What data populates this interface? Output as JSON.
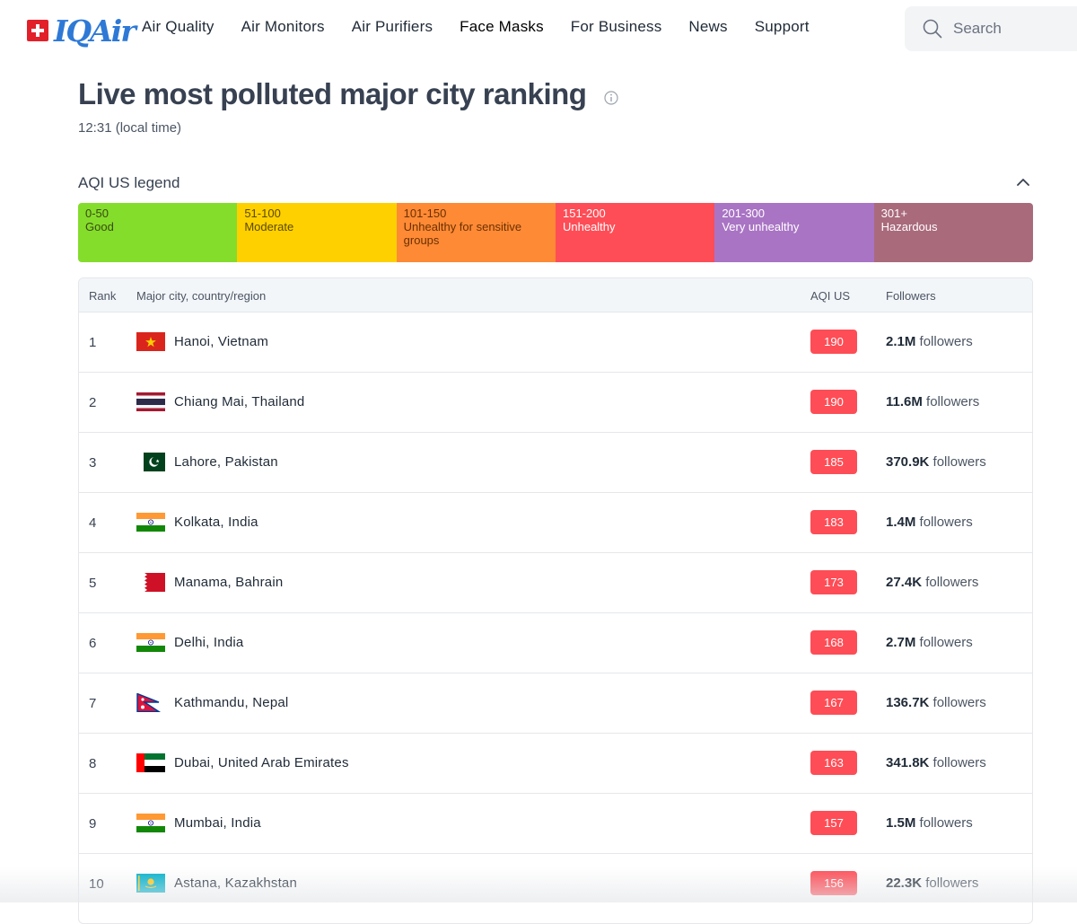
{
  "header": {
    "logo_text": "IQAir",
    "nav": [
      {
        "label": "Air Quality"
      },
      {
        "label": "Air Monitors"
      },
      {
        "label": "Air Purifiers"
      },
      {
        "label": "Face Masks"
      },
      {
        "label": "For Business"
      },
      {
        "label": "News"
      },
      {
        "label": "Support"
      }
    ],
    "search_placeholder": "Search"
  },
  "page": {
    "title": "Live most polluted major city ranking",
    "local_time": "12:31 (local time)"
  },
  "legend": {
    "title": "AQI US legend",
    "segments": [
      {
        "range": "0-50",
        "label": "Good",
        "color": "#84dd2b",
        "text_color": "#3a4a12"
      },
      {
        "range": "51-100",
        "label": "Moderate",
        "color": "#ffd000",
        "text_color": "#5a4a00"
      },
      {
        "range": "101-150",
        "label": "Unhealthy for sensitive groups",
        "color": "#fe8a36",
        "text_color": "#6b3000"
      },
      {
        "range": "151-200",
        "label": "Unhealthy",
        "color": "#fe4d56",
        "text_color": "#ffffff"
      },
      {
        "range": "201-300",
        "label": "Very unhealthy",
        "color": "#a974c4",
        "text_color": "#ffffff"
      },
      {
        "range": "301+",
        "label": "Hazardous",
        "color": "#a96a7c",
        "text_color": "#ffffff"
      }
    ]
  },
  "table": {
    "headers": {
      "rank": "Rank",
      "city": "Major city, country/region",
      "aqi": "AQI US",
      "followers": "Followers"
    },
    "followers_suffix": "followers",
    "rows": [
      {
        "rank": "1",
        "city": "Hanoi, Vietnam",
        "flag": "vietnam",
        "aqi": "190",
        "followers": "2.1M"
      },
      {
        "rank": "2",
        "city": "Chiang Mai, Thailand",
        "flag": "thailand",
        "aqi": "190",
        "followers": "11.6M"
      },
      {
        "rank": "3",
        "city": "Lahore, Pakistan",
        "flag": "pakistan",
        "aqi": "185",
        "followers": "370.9K"
      },
      {
        "rank": "4",
        "city": "Kolkata, India",
        "flag": "india",
        "aqi": "183",
        "followers": "1.4M"
      },
      {
        "rank": "5",
        "city": "Manama, Bahrain",
        "flag": "bahrain",
        "aqi": "173",
        "followers": "27.4K"
      },
      {
        "rank": "6",
        "city": "Delhi, India",
        "flag": "india",
        "aqi": "168",
        "followers": "2.7M"
      },
      {
        "rank": "7",
        "city": "Kathmandu, Nepal",
        "flag": "nepal",
        "aqi": "167",
        "followers": "136.7K"
      },
      {
        "rank": "8",
        "city": "Dubai, United Arab Emirates",
        "flag": "uae",
        "aqi": "163",
        "followers": "341.8K"
      },
      {
        "rank": "9",
        "city": "Mumbai, India",
        "flag": "india",
        "aqi": "157",
        "followers": "1.5M"
      },
      {
        "rank": "10",
        "city": "Astana, Kazakhstan",
        "flag": "kazakhstan",
        "aqi": "156",
        "followers": "22.3K"
      }
    ]
  }
}
